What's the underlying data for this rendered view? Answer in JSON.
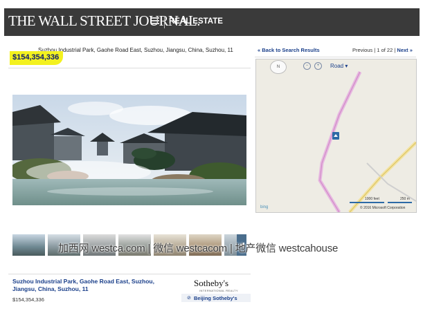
{
  "header": {
    "logo": "THE WALL STREET JOURNAL.",
    "section": "REAL ESTATE"
  },
  "listing": {
    "address": "Suzhou Industrial Park, Gaohe Road East, Suzhou, Jiangsu, China, Suzhou, 11",
    "price": "$154,354,336"
  },
  "nav": {
    "back_link": "« Back to Search Results",
    "previous": "Previous",
    "pager": "1 of 22",
    "next": "Next »"
  },
  "map": {
    "compass": "N",
    "road_dropdown": "Road ▾",
    "scale_left": "1000 feet",
    "scale_right": "250 m",
    "copyright": "© 2016 Microsoft Corporation",
    "provider": "bing"
  },
  "thumbnails": {
    "count": 7,
    "next_arrow": "◀"
  },
  "watermark": "加西网 westca.com | 微信 westcacom | 地产微信 westcahouse",
  "card": {
    "address": "Suzhou Industrial Park, Gaohe Road East, Suzhou, Jiangsu, China, Suzhou, 11",
    "price": "$154,354,336",
    "brand": "Sotheby's",
    "brand_sub": "INTERNATIONAL REALTY",
    "agent": "Beijing Sotheby's"
  },
  "colors": {
    "header_bg": "#3a3a3a",
    "price_highlight": "#f3f11f",
    "link": "#1a3f8a"
  }
}
